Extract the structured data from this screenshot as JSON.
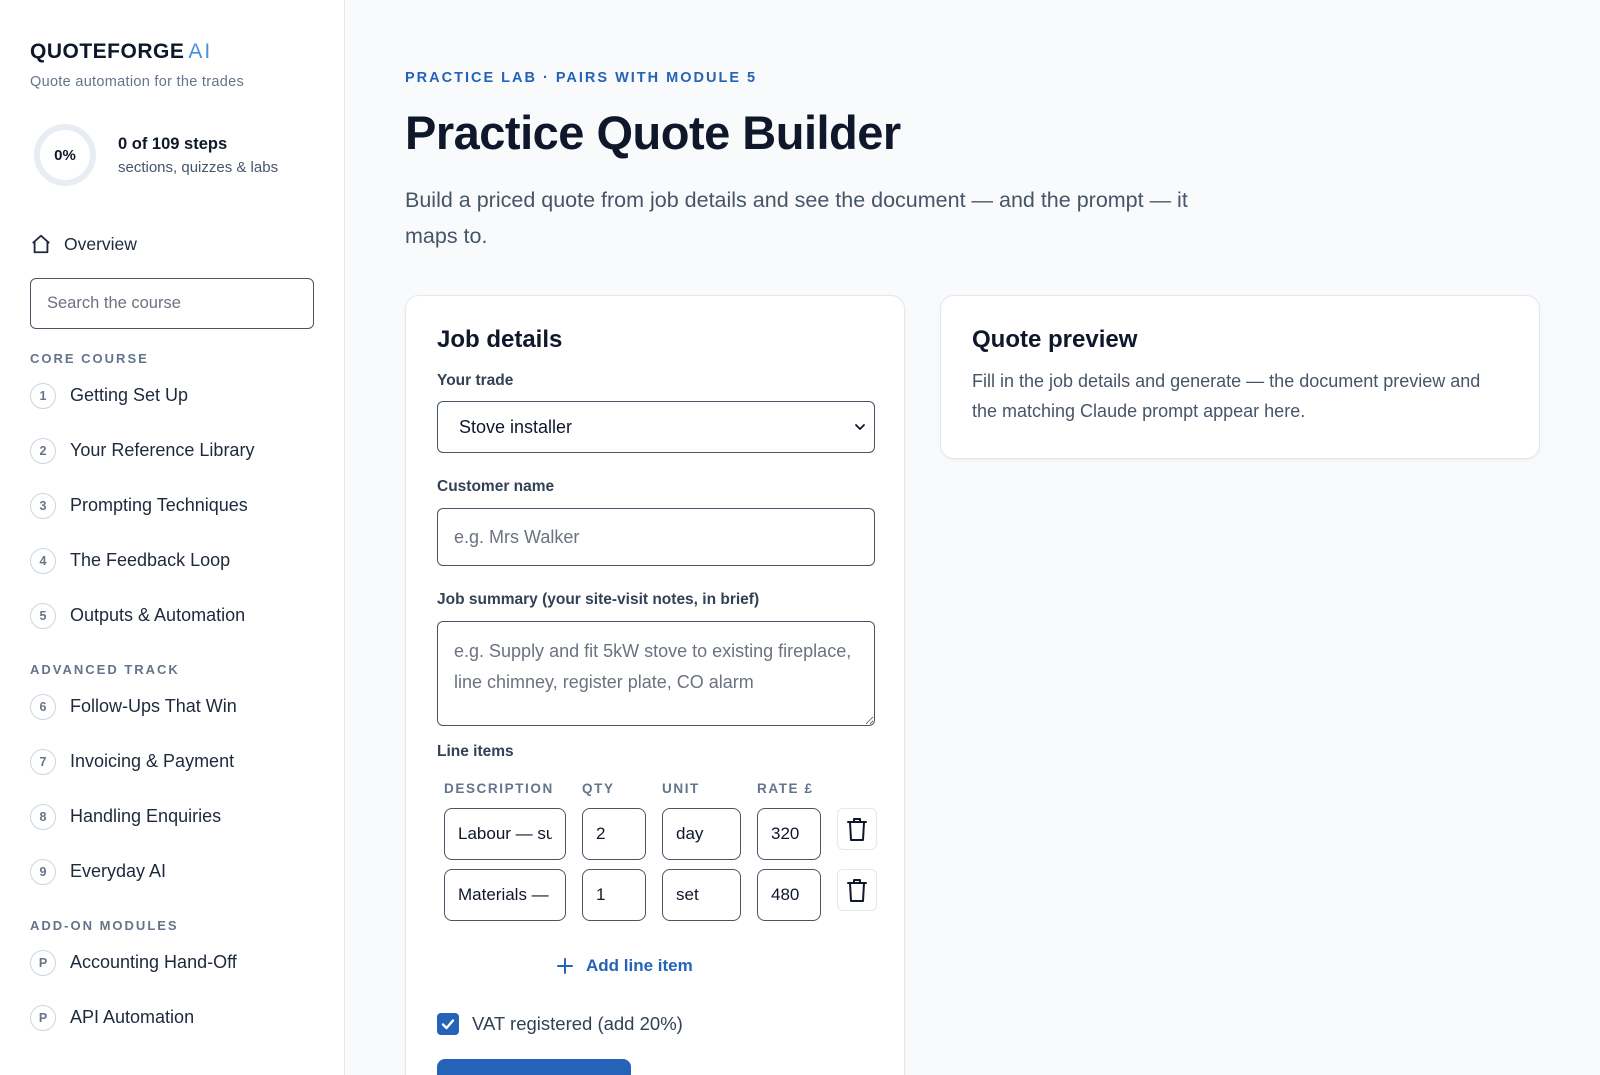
{
  "sidebar": {
    "brand": "QUOTEFORGE",
    "brand_suffix": "AI",
    "tagline": "Quote automation for the trades",
    "progress": {
      "percent_label": "0%",
      "value": 0,
      "title": "0 of 109 steps",
      "subtitle": "sections, quizzes & labs"
    },
    "overview_label": "Overview",
    "search_placeholder": "Search the course",
    "sections": [
      {
        "label": "CORE COURSE",
        "items": [
          {
            "num": "1",
            "label": "Getting Set Up"
          },
          {
            "num": "2",
            "label": "Your Reference Library"
          },
          {
            "num": "3",
            "label": "Prompting Techniques"
          },
          {
            "num": "4",
            "label": "The Feedback Loop"
          },
          {
            "num": "5",
            "label": "Outputs & Automation"
          }
        ]
      },
      {
        "label": "ADVANCED TRACK",
        "items": [
          {
            "num": "6",
            "label": "Follow-Ups That Win"
          },
          {
            "num": "7",
            "label": "Invoicing & Payment"
          },
          {
            "num": "8",
            "label": "Handling Enquiries"
          },
          {
            "num": "9",
            "label": "Everyday AI"
          }
        ]
      },
      {
        "label": "ADD-ON MODULES",
        "items": [
          {
            "num": "P",
            "label": "Accounting Hand-Off"
          },
          {
            "num": "P",
            "label": "API Automation"
          }
        ]
      }
    ]
  },
  "main": {
    "eyebrow": "PRACTICE LAB · PAIRS WITH MODULE 5",
    "title": "Practice Quote Builder",
    "description": "Build a priced quote from job details and see the document — and the prompt — it maps to.",
    "job_details": {
      "title": "Job details",
      "trade_label": "Your trade",
      "trade_value": "Stove installer",
      "customer_label": "Customer name",
      "customer_placeholder": "e.g. Mrs Walker",
      "summary_label": "Job summary (your site-visit notes, in brief)",
      "summary_placeholder": "e.g. Supply and fit 5kW stove to existing fireplace, line chimney, register plate, CO alarm",
      "line_items_label": "Line items",
      "columns": {
        "description": "DESCRIPTION",
        "qty": "QTY",
        "unit": "UNIT",
        "rate": "RATE £"
      },
      "line_items": [
        {
          "description": "Labour — supply and fit",
          "qty": "2",
          "unit": "day",
          "rate": "320"
        },
        {
          "description": "Materials — stove and flue",
          "qty": "1",
          "unit": "set",
          "rate": "480"
        }
      ],
      "add_line_label": "Add line item",
      "vat_label": "VAT registered (add 20%)",
      "vat_checked": true
    },
    "preview": {
      "title": "Quote preview",
      "text": "Fill in the job details and generate — the document preview and the matching Claude prompt appear here."
    }
  },
  "colors": {
    "accent": "#2563b8",
    "brand_ai": "#4a90d9",
    "background": "#f8fafc"
  },
  "icons": {
    "overview": "home-icon",
    "delete": "trash-icon",
    "add": "plus-icon",
    "select": "chevron-down-icon",
    "checkbox": "check-icon"
  }
}
